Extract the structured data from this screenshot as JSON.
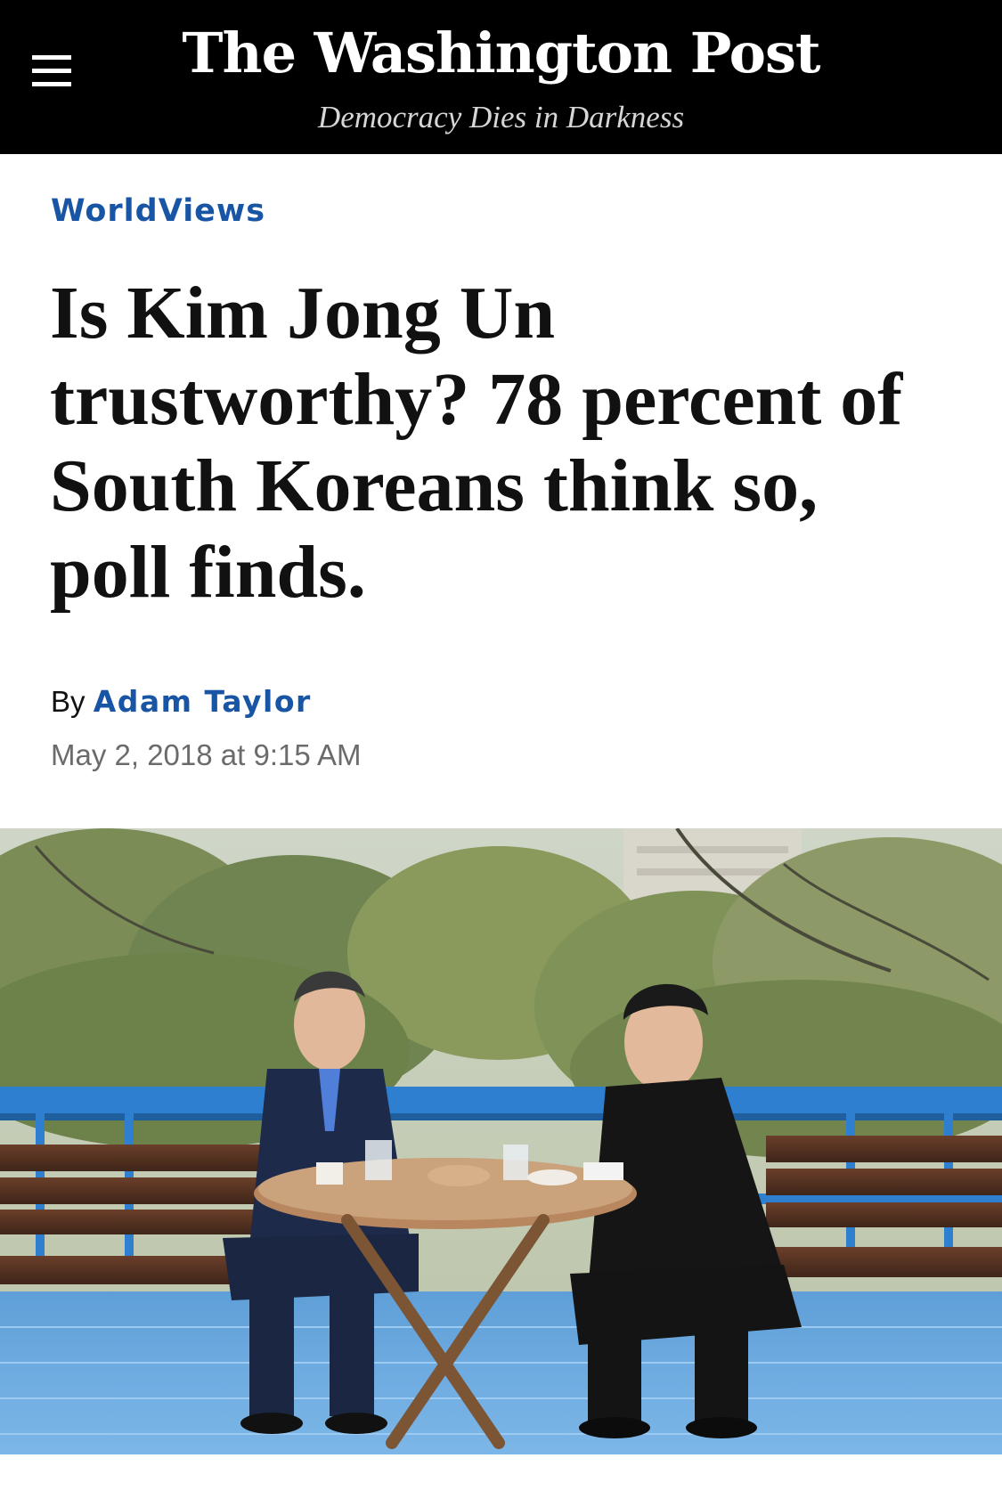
{
  "header": {
    "masthead": "The Washington Post",
    "tagline": "Democracy Dies in Darkness",
    "menu_icon": "hamburger-menu-icon"
  },
  "article": {
    "section": "WorldViews",
    "headline": "Is Kim Jong Un trustworthy? 78 percent of South Koreans think so, poll finds.",
    "byline_prefix": "By",
    "author": "Adam Taylor",
    "timestamp": "May 2, 2018 at 9:15 AM"
  },
  "colors": {
    "header_background": "#000000",
    "link_blue": "#1955a5",
    "headline_text": "#111111",
    "meta_gray": "#6b6b6b"
  }
}
